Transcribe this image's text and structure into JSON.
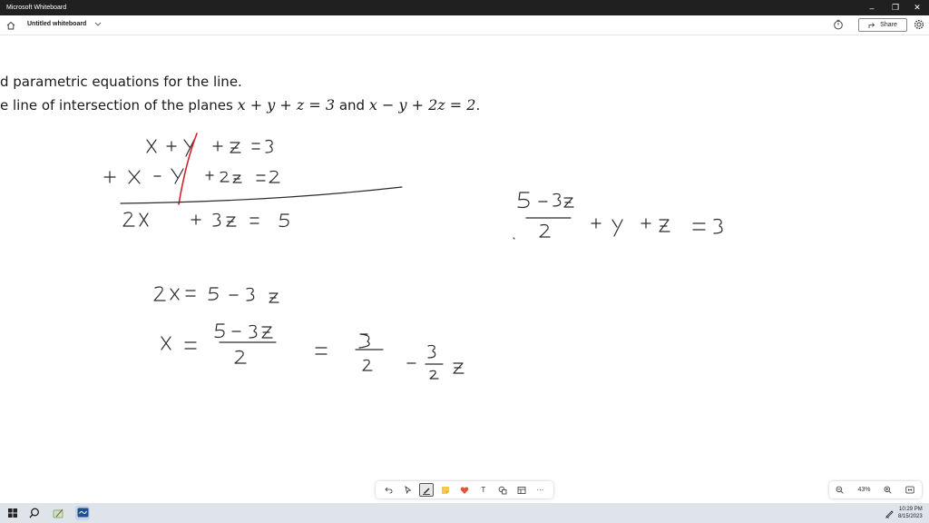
{
  "window": {
    "title": "Microsoft Whiteboard",
    "minimize_glyph": "–",
    "restore_glyph": "❐",
    "close_glyph": "✕"
  },
  "appbar": {
    "board_title": "Untitled whiteboard",
    "share_label": "Share",
    "icons": [
      "home-icon",
      "chevron-down-icon",
      "timer-icon",
      "share-icon",
      "gear-icon"
    ]
  },
  "problem": {
    "line1": "d parametric equations for the line.",
    "line2_prefix": "e line of intersection of the planes",
    "eq1": "x + y + z = 3",
    "conj": "and",
    "eq2": "x − y + 2z = 2",
    "end": "."
  },
  "toolbar": {
    "tools": [
      "undo-icon",
      "select-icon",
      "pen-icon",
      "sticky-note-icon",
      "reaction-icon",
      "text-icon",
      "shapes-icon",
      "templates-icon",
      "more-icon"
    ],
    "more_glyph": "···",
    "text_glyph": "T"
  },
  "zoom": {
    "level": "43%"
  },
  "taskbar": {
    "time": "10:29 PM",
    "date": "8/15/2023"
  },
  "colors": {
    "ink": "#2b2b2b",
    "red_ink": "#d3202a",
    "titlebar": "#202020",
    "taskbar": "#dfe3ea"
  }
}
